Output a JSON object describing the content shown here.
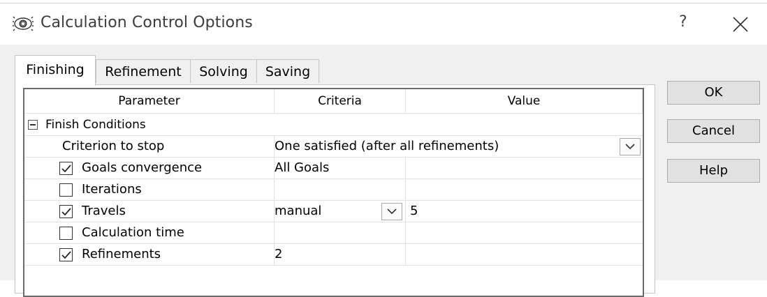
{
  "window": {
    "title": "Calculation Control Options",
    "help_glyph": "?",
    "app_icon": "gear-eye-icon",
    "close_icon": "close-icon"
  },
  "tabs": [
    {
      "label": "Finishing",
      "active": true
    },
    {
      "label": "Refinement",
      "active": false
    },
    {
      "label": "Solving",
      "active": false
    },
    {
      "label": "Saving",
      "active": false
    }
  ],
  "grid": {
    "columns": [
      "Parameter",
      "Criteria",
      "Value"
    ],
    "group_label": "Finish Conditions",
    "rows": [
      {
        "parameter": "Criterion to stop",
        "criteria": "One satisfied (after all refinements)",
        "value": "",
        "checkbox": null,
        "dropdown": "criteria-wide"
      },
      {
        "parameter": "Goals convergence",
        "criteria": "All Goals",
        "value": "",
        "checkbox": true,
        "dropdown": null
      },
      {
        "parameter": "Iterations",
        "criteria": "",
        "value": "",
        "checkbox": false,
        "dropdown": null
      },
      {
        "parameter": "Travels",
        "criteria": "manual",
        "value": "5",
        "checkbox": true,
        "dropdown": "criteria"
      },
      {
        "parameter": "Calculation time",
        "criteria": "",
        "value": "",
        "checkbox": false,
        "dropdown": null
      },
      {
        "parameter": "Refinements",
        "criteria": "2",
        "value": "",
        "checkbox": true,
        "dropdown": null
      }
    ]
  },
  "buttons": {
    "ok": "OK",
    "cancel": "Cancel",
    "help": "Help"
  }
}
